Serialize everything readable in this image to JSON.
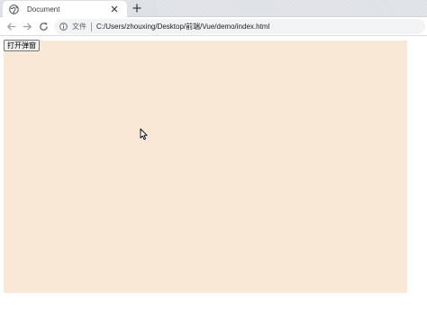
{
  "browser": {
    "tabs": [
      {
        "title": "Document",
        "favicon": "globe-icon",
        "active": true
      }
    ],
    "close_icon": "close-icon",
    "new_tab_icon": "plus-icon",
    "nav": {
      "back_icon": "back-arrow-icon",
      "forward_icon": "forward-arrow-icon",
      "reload_icon": "reload-icon"
    },
    "address_bar": {
      "site_info_icon": "info-icon",
      "site_label": "文件",
      "url": "C:/Users/zhouxing/Desktop/前端/Vue/demo/index.html"
    }
  },
  "page": {
    "background_color": "#f9e8d5",
    "open_button_label": "打开弹窗"
  }
}
